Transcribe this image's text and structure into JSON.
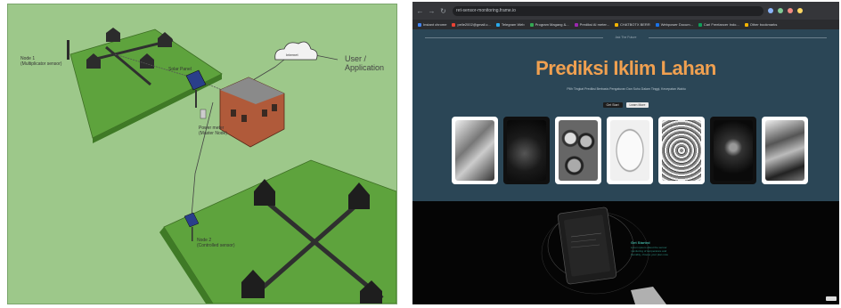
{
  "diagram": {
    "node1_label": "Node 1",
    "node1_sub": "(Multiplicator sensor)",
    "node2_label": "Node 2",
    "node2_sub": "(Controlled sensor)",
    "solar_label": "Solar Panel",
    "power_label": "Power meter",
    "power_sub": "(Master Node)",
    "cloud_label": "Internet",
    "user_label": "User /",
    "user_label2": "Application"
  },
  "browser": {
    "url": "ret-sensor-monitoring.frame.io",
    "nav": {
      "back": "←",
      "forward": "→",
      "reload": "↻"
    },
    "bookmarks": [
      {
        "label": "Instant chrome",
        "color": "#4285f4"
      },
      {
        "label": "pelle2002@gmail.c...",
        "color": "#ea4335"
      },
      {
        "label": "Telegram Web",
        "color": "#29a9eb"
      },
      {
        "label": "Program Magang &...",
        "color": "#34a853"
      },
      {
        "label": "Prediksi AI meter...",
        "color": "#9c27b0"
      },
      {
        "label": "CHATBOTX BERR",
        "color": "#f4b400"
      },
      {
        "label": "Webpower Docum...",
        "color": "#1a73e8"
      },
      {
        "label": "Cari Freelancer Indo...",
        "color": "#0f9d58"
      },
      {
        "label": "Other bookmarks",
        "color": "#f4b400"
      }
    ],
    "extension_colors": [
      "#8ab4f8",
      "#81c995",
      "#f28b82",
      "#fdd663"
    ]
  },
  "page": {
    "top_label": "Ask The Future",
    "hero_title": "Prediksi Iklim Lahan",
    "hero_subtitle": "Pilih Tingkat Prediksi Berbasis Pengaturan Dan Suhu Dalam Tinggi, Kecepatan Waktu",
    "btn_primary": "Get Start",
    "btn_secondary": "Learn More",
    "lower_title": "Get Started",
    "lower_text": "Lorem ipsum about the sensor monitoring of temperature and humidity, choose your plan now"
  },
  "cards": [
    {
      "name": "card-1",
      "theme": "light"
    },
    {
      "name": "card-2",
      "theme": "dark"
    },
    {
      "name": "card-3",
      "theme": "light"
    },
    {
      "name": "card-4",
      "theme": "light"
    },
    {
      "name": "card-5",
      "theme": "light"
    },
    {
      "name": "card-6",
      "theme": "dark"
    },
    {
      "name": "card-7",
      "theme": "light"
    }
  ]
}
